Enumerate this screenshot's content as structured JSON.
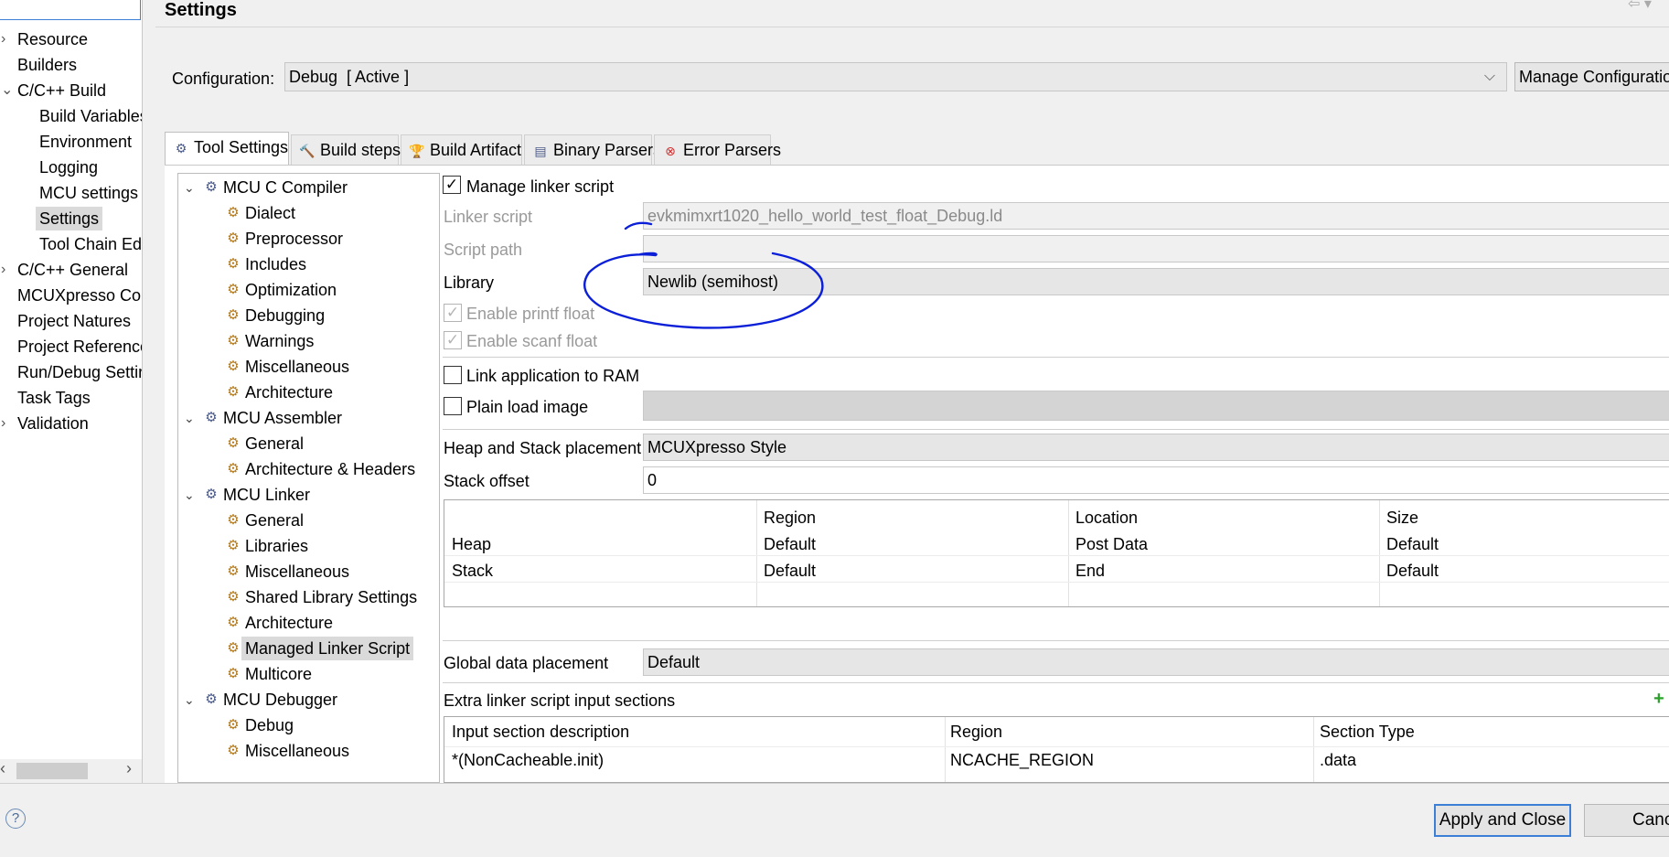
{
  "left_nav": {
    "items": [
      {
        "label": "Resource",
        "arrow": "›"
      },
      {
        "label": "Builders",
        "arrow": ""
      },
      {
        "label": "C/C++ Build",
        "arrow": "⌄"
      },
      {
        "label": "Build Variables",
        "arrow": ""
      },
      {
        "label": "Environment",
        "arrow": ""
      },
      {
        "label": "Logging",
        "arrow": ""
      },
      {
        "label": "MCU settings",
        "arrow": ""
      },
      {
        "label": "Settings",
        "arrow": ""
      },
      {
        "label": "Tool Chain Edi",
        "arrow": ""
      },
      {
        "label": "C/C++ General",
        "arrow": "›"
      },
      {
        "label": "MCUXpresso Cor",
        "arrow": ""
      },
      {
        "label": "Project Natures",
        "arrow": ""
      },
      {
        "label": "Project Reference:",
        "arrow": ""
      },
      {
        "label": "Run/Debug Settir",
        "arrow": ""
      },
      {
        "label": "Task Tags",
        "arrow": ""
      },
      {
        "label": "Validation",
        "arrow": "›"
      }
    ]
  },
  "header": {
    "title": "Settings"
  },
  "config": {
    "label": "Configuration:",
    "value": "Debug  [ Active ]",
    "manage_label": "Manage Configuratio"
  },
  "tabs": [
    {
      "label": "Tool Settings",
      "icon": "⚙"
    },
    {
      "label": "Build steps",
      "icon": "🔨"
    },
    {
      "label": "Build Artifact",
      "icon": "🏆"
    },
    {
      "label": "Binary Parsers",
      "icon": "▤"
    },
    {
      "label": "Error Parsers",
      "icon": "⊗"
    }
  ],
  "tool_tree": [
    {
      "label": "MCU C Compiler",
      "group": true
    },
    {
      "label": "Dialect",
      "group": false
    },
    {
      "label": "Preprocessor",
      "group": false
    },
    {
      "label": "Includes",
      "group": false
    },
    {
      "label": "Optimization",
      "group": false
    },
    {
      "label": "Debugging",
      "group": false
    },
    {
      "label": "Warnings",
      "group": false
    },
    {
      "label": "Miscellaneous",
      "group": false
    },
    {
      "label": "Architecture",
      "group": false
    },
    {
      "label": "MCU Assembler",
      "group": true
    },
    {
      "label": "General",
      "group": false
    },
    {
      "label": "Architecture & Headers",
      "group": false
    },
    {
      "label": "MCU Linker",
      "group": true
    },
    {
      "label": "General",
      "group": false
    },
    {
      "label": "Libraries",
      "group": false
    },
    {
      "label": "Miscellaneous",
      "group": false
    },
    {
      "label": "Shared Library Settings",
      "group": false
    },
    {
      "label": "Architecture",
      "group": false
    },
    {
      "label": "Managed Linker Script",
      "group": false
    },
    {
      "label": "Multicore",
      "group": false
    },
    {
      "label": "MCU Debugger",
      "group": true
    },
    {
      "label": "Debug",
      "group": false
    },
    {
      "label": "Miscellaneous",
      "group": false
    }
  ],
  "linker": {
    "manage_linker_script_label": "Manage linker script",
    "manage_linker_script_checked": true,
    "linker_script_label": "Linker script",
    "linker_script_value": "evkmimxrt1020_hello_world_test_float_Debug.ld",
    "script_path_label": "Script path",
    "script_path_value": "",
    "library_label": "Library",
    "library_value": "Newlib (semihost)",
    "printf_float_label": "Enable printf float",
    "scanf_float_label": "Enable scanf float",
    "link_to_ram_label": "Link application to RAM",
    "link_to_ram_checked": false,
    "plain_load_label": "Plain load image",
    "plain_load_checked": false,
    "heap_stack_label": "Heap and Stack placement",
    "heap_stack_value": "MCUXpresso Style",
    "stack_offset_label": "Stack offset",
    "stack_offset_value": "0",
    "global_data_label": "Global data placement",
    "global_data_value": "Default",
    "extra_sections_label": "Extra linker script input sections",
    "add_icon": "+"
  },
  "heap_table": {
    "columns": [
      "",
      "Region",
      "Location",
      "Size"
    ],
    "rows": [
      [
        "Heap",
        "Default",
        "Post Data",
        "Default"
      ],
      [
        "Stack",
        "Default",
        "End",
        "Default"
      ]
    ]
  },
  "sections_table": {
    "columns": [
      "Input section description",
      "Region",
      "Section Type"
    ],
    "rows": [
      [
        "*(NonCacheable.init)",
        "NCACHE_REGION",
        ".data"
      ]
    ]
  },
  "footer": {
    "help": "?",
    "apply_label": "Apply and Close",
    "cancel_label": "Cance"
  },
  "annotation_color": "#0b1fd8"
}
